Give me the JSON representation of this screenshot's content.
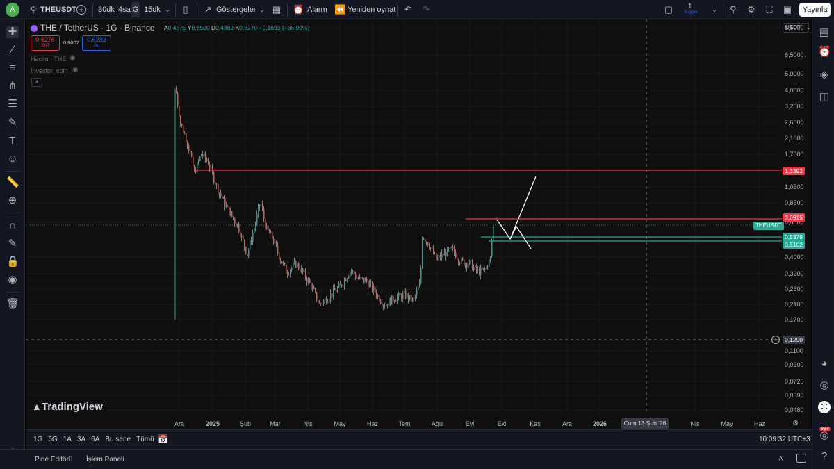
{
  "toolbar": {
    "avatar_letter": "A",
    "symbol": "THEUSDT",
    "intervals": [
      "30dk",
      "4sa",
      "G",
      "15dk"
    ],
    "active_interval": "G",
    "indicators_label": "Göstergeler",
    "alarm_label": "Alarm",
    "replay_label": "Yeniden oynat",
    "save_count": "1",
    "save_label": "Kaydet",
    "publish_label": "Yayınla"
  },
  "legend": {
    "title": "THE / TetherUS · 1G · Binance",
    "o_label": "A",
    "o_value": "0,4575",
    "h_label": "Y",
    "h_value": "0,6500",
    "l_label": "D",
    "l_value": "0,4382",
    "c_label": "K",
    "c_value": "0,6270",
    "change": "+0,1693 (+36,99%)",
    "sell_price": "0,6276",
    "sell_label": "SAT",
    "spread": "0,0007",
    "buy_price": "0,6283",
    "buy_label": "AL",
    "indicator1": "Hacim · THE",
    "indicator2": "Investor_coin"
  },
  "price_axis": {
    "currency": "USDT",
    "ticks": [
      "8,5000",
      "6,5000",
      "5,0000",
      "4,0000",
      "3,2000",
      "2,6000",
      "2,1000",
      "1,7000",
      "1,0500",
      "0,8500",
      "0,6500",
      "0,4000",
      "0,3200",
      "0,2600",
      "0,2100",
      "0,1700",
      "0,1100",
      "0,0900",
      "0,0720",
      "0,0590",
      "0,0480"
    ],
    "tags": {
      "line_red_top": "1,3392",
      "line_red_mid": "0,6915",
      "symbol_tag": "THEUSDT",
      "line_green_1": "0,5379",
      "line_green_2": "0,5102",
      "crosshair": "0,1290"
    }
  },
  "time_axis": {
    "labels": [
      "Ara",
      "2025",
      "Şub",
      "Mar",
      "Nis",
      "May",
      "Haz",
      "Tem",
      "Ağu",
      "Eyl",
      "Eki",
      "Kas",
      "Ara",
      "2026",
      "Nis",
      "May",
      "Haz"
    ],
    "crosshair_label": "Cum 13 Şub '26"
  },
  "watermark": "TradingView",
  "bottom": {
    "ranges": [
      "1G",
      "5G",
      "1A",
      "3A",
      "6A",
      "Bu sene",
      "Tümü"
    ],
    "clock": "10:09:32 UTC+3"
  },
  "footer": {
    "tab1": "Pine Editörü",
    "tab2": "İşlem Paneli"
  },
  "notifications_badge": "99+",
  "colors": {
    "up": "#26a69a",
    "down": "#ef5350",
    "red_line": "#f23645",
    "green_line": "#22ab94",
    "accent": "#2962ff"
  },
  "chart_data": {
    "type": "candlestick",
    "price_scale": "log",
    "horizontal_levels": [
      1.3392,
      0.6915,
      0.5379,
      0.5102
    ],
    "last_close": 0.627,
    "crosshair_price": 0.129
  }
}
